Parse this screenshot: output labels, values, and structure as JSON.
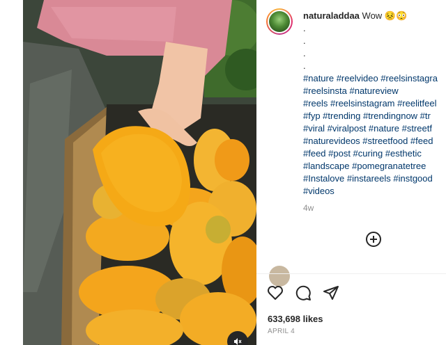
{
  "post": {
    "username": "naturaladdaa",
    "caption_text": "Wow 😣😳",
    "dots": [
      ".",
      ".",
      ".",
      "."
    ],
    "hashtag_lines": [
      "#nature #reelvideo #reelsinstagra",
      "#reelsinsta #natureview",
      "#reels #reelsinstagram #reelitfeel",
      "#fyp #trending #trendingnow #tr",
      "#viral #viralpost #nature #streetf",
      "#naturevideos #streetfood #feed",
      "#feed #post #curing #esthetic",
      "#landscape #pomegranatetree",
      "#Instalove #instareels #instgood",
      "#videos"
    ],
    "time_ago": "4w",
    "likes": "633,698 likes",
    "date": "APRIL 4"
  },
  "icons": {
    "like": "heart-icon",
    "comment": "comment-icon",
    "share": "share-icon",
    "add": "plus-circle-icon",
    "mute": "muted-speaker-icon"
  },
  "colors": {
    "mango": "#f4a51c",
    "hashtag": "#00376b",
    "muted_text": "#8e8e8e"
  }
}
